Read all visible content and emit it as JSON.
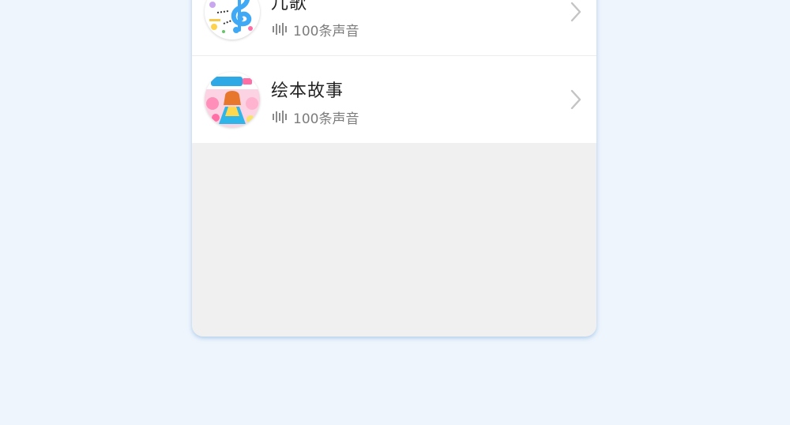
{
  "list": {
    "items": [
      {
        "title": "儿歌",
        "count_text": "100条声音",
        "avatar_icon": "music-note-icon",
        "chevron_icon": "chevron-right-icon"
      },
      {
        "title": "绘本故事",
        "count_text": "100条声音",
        "avatar_icon": "princess-story-cover-icon",
        "chevron_icon": "chevron-right-icon"
      }
    ]
  },
  "colors": {
    "page_background": "#eef5fd",
    "card_empty_area": "#f0f0f0",
    "title_text": "#222222",
    "meta_text": "#7c7c7c",
    "chevron": "#c4c4c4",
    "card_shadow": "#78aadc"
  }
}
